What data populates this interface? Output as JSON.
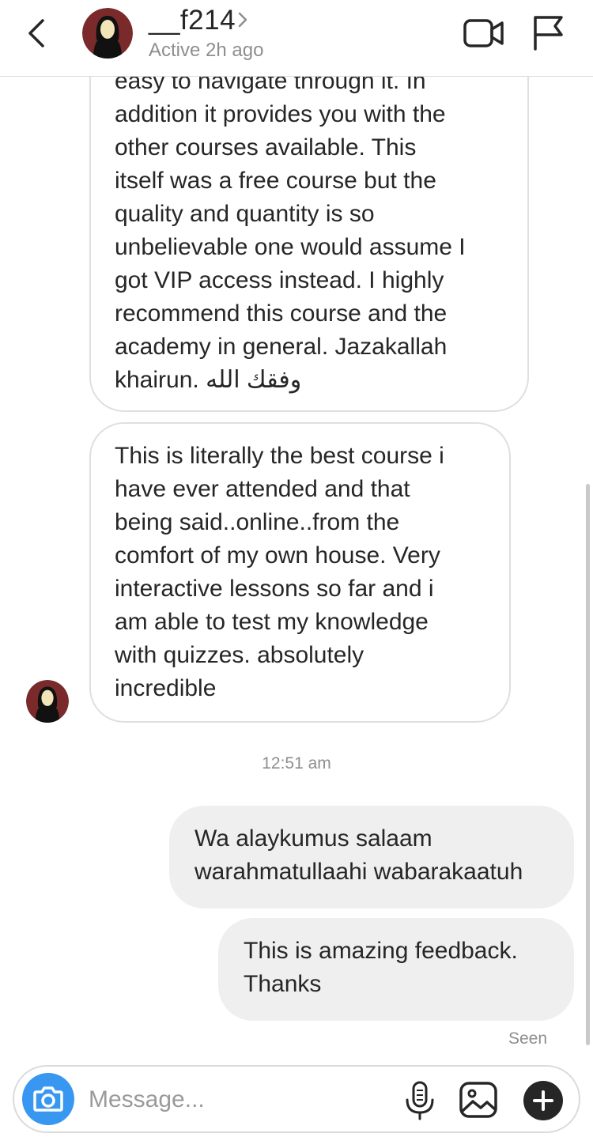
{
  "header": {
    "username": "__f214",
    "status": "Active 2h ago"
  },
  "messages": [
    {
      "direction": "incoming",
      "text": "easy to navigate through it. In\naddition it provides you with  the\nother courses available. This\nitself was a free course but the\nquality and quantity is so\nunbelievable one would assume I\ngot VIP access instead. I highly\nrecommend this course and the\nacademy in general. Jazakallah\nkhairun. وفقك الله"
    },
    {
      "direction": "incoming",
      "text": "This is literally the best course i\nhave ever attended and that\nbeing said..online..from the\ncomfort of my own house.  Very\ninteractive lessons so far and i\nam able to test my knowledge\nwith quizzes. absolutely\nincredible"
    },
    {
      "direction": "outgoing",
      "text": "Wa alaykumus salaam\nwarahmatullaahi wabarakaatuh"
    },
    {
      "direction": "outgoing",
      "text": "This is amazing feedback.\nThanks"
    }
  ],
  "timestamp": "12:51 am",
  "seen_label": "Seen",
  "composer": {
    "placeholder": "Message...",
    "value": ""
  },
  "icons": {
    "back": "chevron-left-icon",
    "video": "video-camera-icon",
    "flag": "flag-icon",
    "camera": "camera-icon",
    "mic": "microphone-icon",
    "gallery": "image-icon",
    "plus": "plus-icon"
  },
  "colors": {
    "camera_button": "#3897f0",
    "avatar_bg": "#7a2a2a",
    "text": "#262626",
    "muted": "#8e8e8e",
    "outgoing_bubble": "#efefef"
  }
}
